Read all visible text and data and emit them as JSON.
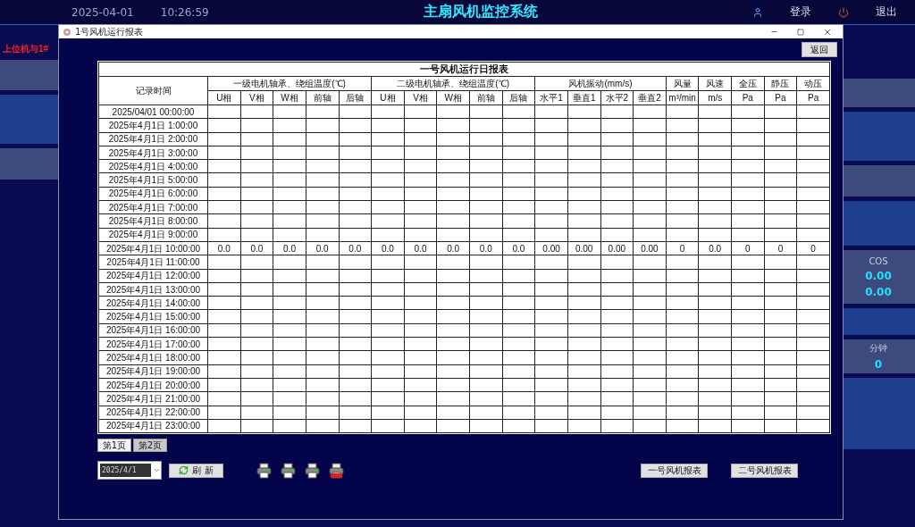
{
  "background": {
    "date": "2025-04-01",
    "time": "10:26:59",
    "title": "主扇风机监控系统",
    "login": "登录",
    "logout": "退出",
    "link_status": "上位机与1#",
    "cos_label": "COS",
    "cos_values": [
      "0.00",
      "0.00"
    ],
    "minutes_label": "分钟",
    "minutes_value": "0"
  },
  "dialog": {
    "title": "1号风机运行报表",
    "back_button": "返回",
    "report": {
      "title": "一号风机运行日报表",
      "time_header": "记录时间",
      "groups": [
        {
          "label": "一级电机轴承、绕组温度(℃)",
          "columns": [
            "U相",
            "V相",
            "W相",
            "前轴",
            "后轴"
          ]
        },
        {
          "label": "二级电机轴承、绕组温度(℃)",
          "columns": [
            "U相",
            "V相",
            "W相",
            "前轴",
            "后轴"
          ]
        },
        {
          "label": "风机振动(mm/s)",
          "columns": [
            "水平1",
            "垂直1",
            "水平2",
            "垂直2"
          ]
        },
        {
          "label": "风量",
          "columns": [
            "m³/min"
          ]
        },
        {
          "label": "风速",
          "columns": [
            "m/s"
          ]
        },
        {
          "label": "全压",
          "columns": [
            "Pa"
          ]
        },
        {
          "label": "静压",
          "columns": [
            "Pa"
          ]
        },
        {
          "label": "动压",
          "columns": [
            "Pa"
          ]
        }
      ],
      "rows": [
        {
          "time": "2025/04/01 00:00:00"
        },
        {
          "time": "2025年4月1日 1:00:00"
        },
        {
          "time": "2025年4月1日 2:00:00"
        },
        {
          "time": "2025年4月1日 3:00:00"
        },
        {
          "time": "2025年4月1日 4:00:00"
        },
        {
          "time": "2025年4月1日 5:00:00"
        },
        {
          "time": "2025年4月1日 6:00:00"
        },
        {
          "time": "2025年4月1日 7:00:00"
        },
        {
          "time": "2025年4月1日 8:00:00"
        },
        {
          "time": "2025年4月1日 9:00:00"
        },
        {
          "time": "2025年4月1日 10:00:00",
          "values": [
            "0.0",
            "0.0",
            "0.0",
            "0.0",
            "0.0",
            "0.0",
            "0.0",
            "0.0",
            "0.0",
            "0.0",
            "0.00",
            "0.00",
            "0.00",
            "0.00",
            "0",
            "0.0",
            "0",
            "0",
            "0"
          ]
        },
        {
          "time": "2025年4月1日 11:00:00"
        },
        {
          "time": "2025年4月1日 12:00:00"
        },
        {
          "time": "2025年4月1日 13:00:00"
        },
        {
          "time": "2025年4月1日 14:00:00"
        },
        {
          "time": "2025年4月1日 15:00:00"
        },
        {
          "time": "2025年4月1日 16:00:00"
        },
        {
          "time": "2025年4月1日 17:00:00"
        },
        {
          "time": "2025年4月1日 18:00:00"
        },
        {
          "time": "2025年4月1日 19:00:00"
        },
        {
          "time": "2025年4月1日 20:00:00"
        },
        {
          "time": "2025年4月1日 21:00:00"
        },
        {
          "time": "2025年4月1日 22:00:00"
        },
        {
          "time": "2025年4月1日 23:00:00"
        }
      ]
    },
    "pages": [
      {
        "label": "第1页",
        "selected": true
      },
      {
        "label": "第2页",
        "selected": false
      }
    ],
    "date_select": {
      "value": "2025/4/1"
    },
    "refresh_button": "刷 新",
    "report_buttons": [
      "一号风机报表",
      "二号风机报表"
    ]
  }
}
